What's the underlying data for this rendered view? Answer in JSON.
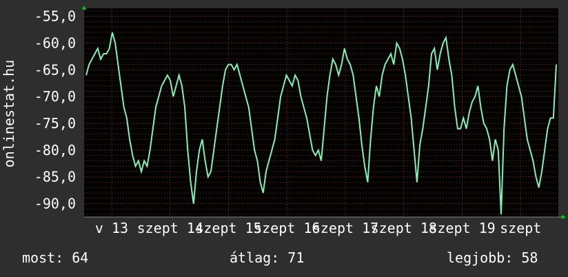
{
  "chart_data": {
    "type": "line",
    "ylabel": "onlinestat.hu",
    "ylim": [
      -92.5,
      -53.5
    ],
    "yticks": [
      {
        "value": -55,
        "label": "-55,0"
      },
      {
        "value": -60,
        "label": "-60,0"
      },
      {
        "value": -65,
        "label": "-65,0"
      },
      {
        "value": -70,
        "label": "-70,0"
      },
      {
        "value": -75,
        "label": "-75,0"
      },
      {
        "value": -80,
        "label": "-80,0"
      },
      {
        "value": -85,
        "label": "-85,0"
      },
      {
        "value": -90,
        "label": "-90,0"
      }
    ],
    "x_ticks": [
      "v 13",
      "szept 14",
      "szept 15",
      "szept 16",
      "szept 17",
      "szept 18",
      "szept 19",
      "szept"
    ],
    "grid": true,
    "series": [
      {
        "values": [
          -66,
          -64,
          -63,
          -62,
          -61,
          -63,
          -62,
          -62,
          -61,
          -58,
          -60,
          -64,
          -68,
          -72,
          -74,
          -78,
          -81,
          -83,
          -82,
          -84,
          -82,
          -83,
          -80,
          -76,
          -72,
          -70,
          -68,
          -67,
          -66,
          -67,
          -70,
          -68,
          -66,
          -68,
          -72,
          -80,
          -86,
          -90,
          -84,
          -80,
          -78,
          -82,
          -85,
          -84,
          -80,
          -76,
          -72,
          -68,
          -65,
          -64,
          -64,
          -65,
          -64,
          -66,
          -68,
          -70,
          -72,
          -76,
          -80,
          -82,
          -86,
          -88,
          -84,
          -82,
          -80,
          -78,
          -74,
          -70,
          -68,
          -66,
          -67,
          -68,
          -66,
          -67,
          -70,
          -72,
          -74,
          -77,
          -80,
          -81,
          -80,
          -82,
          -76,
          -70,
          -66,
          -63,
          -64,
          -66,
          -64,
          -61,
          -63,
          -64,
          -66,
          -70,
          -74,
          -79,
          -83,
          -86,
          -78,
          -72,
          -68,
          -70,
          -66,
          -64,
          -63,
          -62,
          -64,
          -60,
          -61,
          -63,
          -66,
          -70,
          -74,
          -80,
          -86,
          -79,
          -76,
          -72,
          -68,
          -62,
          -61,
          -65,
          -62,
          -60,
          -59,
          -63,
          -66,
          -72,
          -76,
          -76,
          -74,
          -76,
          -73,
          -71,
          -70,
          -68,
          -72,
          -75,
          -76,
          -78,
          -82,
          -78,
          -80,
          -92,
          -76,
          -68,
          -65,
          -64,
          -66,
          -68,
          -70,
          -74,
          -78,
          -80,
          -82,
          -85,
          -87,
          -84,
          -80,
          -76,
          -74,
          -74,
          -64
        ]
      }
    ],
    "stats": {
      "current": "most: 64",
      "average": "átlag: 71",
      "best": "legjobb: 58"
    },
    "colors": {
      "background": "#2e2e2e",
      "plot_background": "#000000",
      "line": "#7df5b4",
      "grid": "#5a1a1a",
      "text": "#ffffff",
      "arrow": "#00d200"
    }
  }
}
